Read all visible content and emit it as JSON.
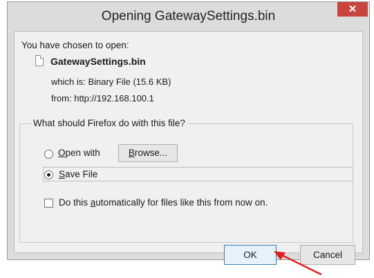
{
  "window": {
    "title": "Opening GatewaySettings.bin",
    "close_glyph": "✕"
  },
  "dialog": {
    "intro": "You have chosen to open:",
    "file_name": "GatewaySettings.bin",
    "which_is": "which is: Binary File (15.6 KB)",
    "from": "from: http://192.168.100.1",
    "question": "What should Firefox do with this file?",
    "open_with": {
      "accel": "O",
      "rest": "pen with",
      "selected": false
    },
    "browse_button": {
      "accel": "B",
      "rest": "rowse..."
    },
    "save_file": {
      "accel": "S",
      "rest": "ave File",
      "selected": true
    },
    "auto_checkbox": {
      "pre": "Do this ",
      "accel": "a",
      "rest": "utomatically for files like this from now on.",
      "checked": false
    },
    "ok_label": "OK",
    "cancel_label": "Cancel"
  },
  "annotation": {
    "arrow_color": "#e02020"
  }
}
